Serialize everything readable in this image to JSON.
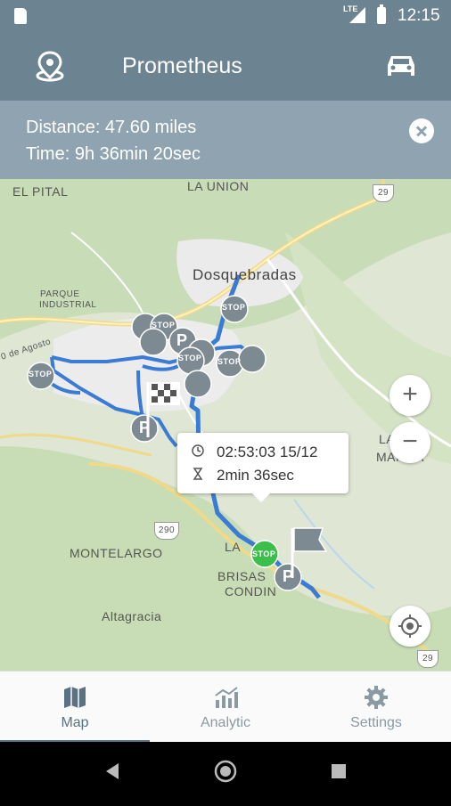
{
  "status_bar": {
    "time": "12:15",
    "network": "LTE"
  },
  "toolbar": {
    "title": "Prometheus",
    "left_icon": "location-pin-icon",
    "right_icon": "car-icon"
  },
  "info": {
    "distance": "Distance: 47.60 miles",
    "time": "Time: 9h 36min 20sec"
  },
  "map": {
    "labels": {
      "el_pital": "EL PITAL",
      "la_union": "LA UNION",
      "dosquebradas": "Dosquebradas",
      "parque_industrial_1": "PARQUE",
      "parque_industrial_2": "INDUSTRIAL",
      "de_agosto": "0 de Agosto",
      "montelargo": "MONTELARGO",
      "la": "LA",
      "brisas": "BRISAS",
      "condina": "CONDIN",
      "altagracia": "Altagracia",
      "la_east": "LA",
      "manga": "MANGA",
      "highway_29_top": "29",
      "highway_29_bottom": "29",
      "highway_290": "290",
      "stop_label": "STOP",
      "parking_label": "P"
    },
    "zoom_in": "+",
    "zoom_out": "−",
    "route_color": "#3a7bd5",
    "marker_color": "#7d8a92",
    "stop_green": "#3bbf4a"
  },
  "popup": {
    "datetime": "02:53:03 15/12",
    "duration": "2min 36sec"
  },
  "bottom_nav": [
    {
      "label": "Map",
      "icon": "map-icon",
      "active": true
    },
    {
      "label": "Analytic",
      "icon": "chart-icon",
      "active": false
    },
    {
      "label": "Settings",
      "icon": "gear-icon",
      "active": false
    }
  ]
}
